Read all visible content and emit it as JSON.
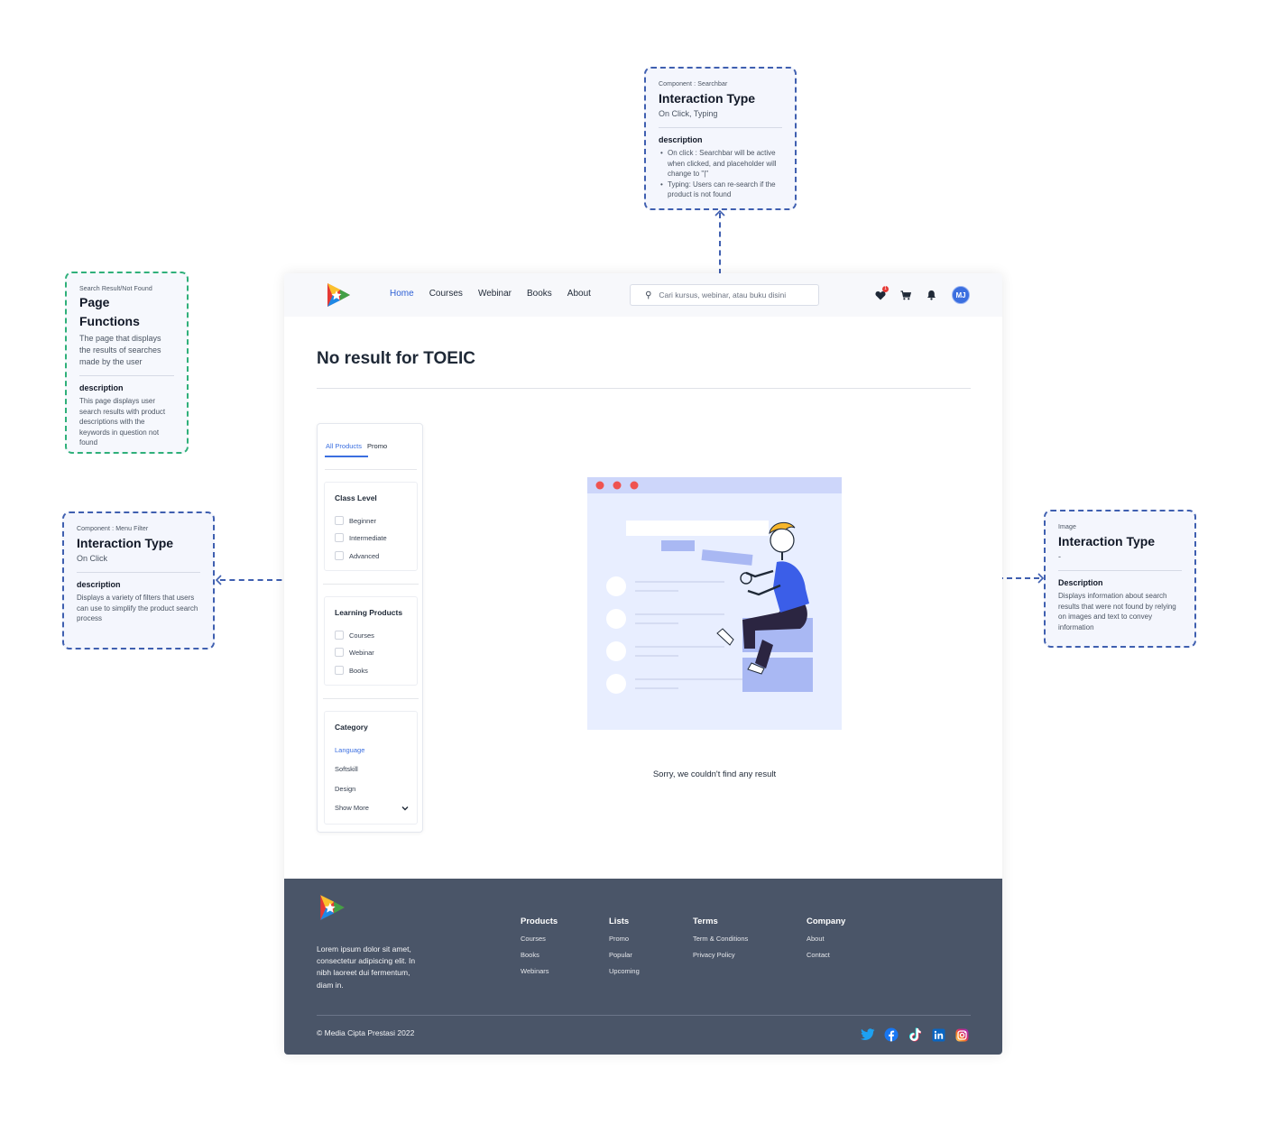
{
  "annotations": {
    "searchbar": {
      "tag": "Component : Searchbar",
      "title": "Interaction Type",
      "subtitle": "On Click, Typing",
      "desc_label": "description",
      "bullets": [
        "On click : Searchbar will be active when clicked, and placeholder will change to \"|\"",
        "Typing: Users can re-search if the product is not found"
      ]
    },
    "page": {
      "tag": "Search Result/Not Found",
      "title_line1": "Page",
      "title_line2": "Functions",
      "subtitle": "The page that displays the results of searches made by the user",
      "desc_label": "description",
      "desc": "This page displays user search results with product descriptions with the keywords in question not found"
    },
    "filter": {
      "tag": "Component : Menu Filter",
      "title": "Interaction Type",
      "subtitle": "On Click",
      "desc_label": "description",
      "desc": "Displays a variety of filters that users can use to simplify the product search process"
    },
    "image": {
      "tag": "Image",
      "title": "Interaction Type",
      "subtitle": "-",
      "desc_label": "Description",
      "desc": "Displays information about search results that were not found by relying on images and text to convey information"
    }
  },
  "nav": {
    "links": [
      "Home",
      "Courses",
      "Webinar",
      "Books",
      "About"
    ],
    "active_index": 0,
    "search_placeholder": "Cari kursus, webinar, atau buku disini",
    "wishlist_badge": "1",
    "avatar_initials": "MJ"
  },
  "main": {
    "result_title": "No result for TOEIC",
    "empty_message": "Sorry, we couldn't find any result"
  },
  "filter": {
    "tabs": [
      "All Products",
      "Promo"
    ],
    "class_level": {
      "title": "Class Level",
      "options": [
        "Beginner",
        "Intermediate",
        "Advanced"
      ]
    },
    "learning_products": {
      "title": "Learning Products",
      "options": [
        "Courses",
        "Webinar",
        "Books"
      ]
    },
    "category": {
      "title": "Category",
      "options": [
        "Language",
        "Softskill",
        "Design"
      ],
      "selected_index": 0,
      "show_more": "Show More"
    }
  },
  "footer": {
    "about": "Lorem ipsum dolor sit amet, consectetur adipiscing elit. In nibh laoreet dui fermentum, diam in.",
    "columns": [
      {
        "title": "Products",
        "links": [
          "Courses",
          "Books",
          "Webinars"
        ]
      },
      {
        "title": "Lists",
        "links": [
          "Promo",
          "Popular",
          "Upcoming"
        ]
      },
      {
        "title": "Terms",
        "links": [
          "Term & Conditions",
          "Privacy Policy"
        ]
      },
      {
        "title": "Company",
        "links": [
          "About",
          "Contact"
        ]
      }
    ],
    "copyright": "© Media Cipta Prestasi 2022",
    "social_icons": [
      "twitter-icon",
      "facebook-icon",
      "tiktok-icon",
      "linkedin-icon",
      "instagram-icon"
    ]
  },
  "colors": {
    "accent": "#2f61d5",
    "footer_bg": "#4a5568",
    "annotation_border": "#3f5fb0",
    "annotation_border_page": "#2fb07a",
    "illustration_bg": "#e8eeff"
  }
}
